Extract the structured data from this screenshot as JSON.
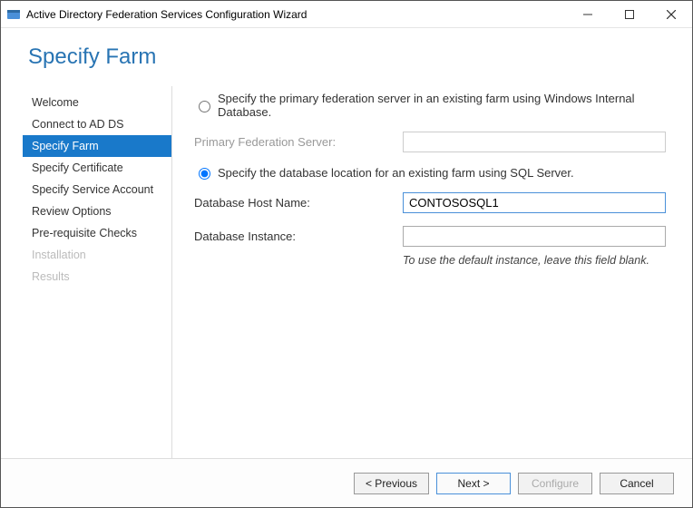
{
  "window": {
    "title": "Active Directory Federation Services Configuration Wizard"
  },
  "header": {
    "title": "Specify Farm"
  },
  "sidebar": {
    "items": [
      {
        "label": "Welcome",
        "state": "normal"
      },
      {
        "label": "Connect to AD DS",
        "state": "normal"
      },
      {
        "label": "Specify Farm",
        "state": "active"
      },
      {
        "label": "Specify Certificate",
        "state": "normal"
      },
      {
        "label": "Specify Service Account",
        "state": "normal"
      },
      {
        "label": "Review Options",
        "state": "normal"
      },
      {
        "label": "Pre-requisite Checks",
        "state": "normal"
      },
      {
        "label": "Installation",
        "state": "disabled"
      },
      {
        "label": "Results",
        "state": "disabled"
      }
    ]
  },
  "main": {
    "option_wid": {
      "label": "Specify the primary federation server in an existing farm using Windows Internal Database.",
      "selected": false
    },
    "primary_server": {
      "label": "Primary Federation Server:",
      "value": ""
    },
    "option_sql": {
      "label": "Specify the database location for an existing farm using SQL Server.",
      "selected": true
    },
    "db_host": {
      "label": "Database Host Name:",
      "value": "CONTOSOSQL1"
    },
    "db_instance": {
      "label": "Database Instance:",
      "value": ""
    },
    "instance_hint": "To use the default instance, leave this field blank."
  },
  "footer": {
    "previous": "< Previous",
    "next": "Next >",
    "configure": "Configure",
    "cancel": "Cancel"
  }
}
